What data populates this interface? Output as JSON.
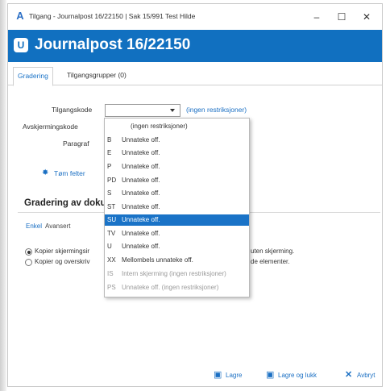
{
  "window": {
    "title": "Tilgang - Journalpost 16/22150 | Sak 15/991 Test Hilde",
    "app_icon": "A",
    "controls": {
      "minimize": "–",
      "maximize": "☐",
      "close": "✕"
    }
  },
  "header": {
    "logo": "U",
    "title": "Journalpost 16/22150",
    "color": "#1170c0"
  },
  "tabs": [
    {
      "label": "Gradering",
      "active": true
    },
    {
      "label": "Tilgangsgrupper (0)",
      "active": false
    }
  ],
  "form": {
    "tilgangskode_label": "Tilgangskode",
    "tilgangskode_value": "",
    "tilgangskode_hint": "(ingen restriksjoner)",
    "avskjermingskode_label": "Avskjermingskode",
    "paragraf_label": "Paragraf",
    "tom_felter": "Tøm felter"
  },
  "dropdown": {
    "options": [
      {
        "code": "",
        "desc": "(ingen restriksjoner)",
        "state": "normal"
      },
      {
        "code": "B",
        "desc": "Unnateke off.",
        "state": "normal"
      },
      {
        "code": "E",
        "desc": "Unnateke off.",
        "state": "normal"
      },
      {
        "code": "P",
        "desc": "Unnateke off.",
        "state": "normal"
      },
      {
        "code": "PD",
        "desc": "Unnateke off.",
        "state": "normal"
      },
      {
        "code": "S",
        "desc": "Unnateke off.",
        "state": "normal"
      },
      {
        "code": "ST",
        "desc": "Unnateke off.",
        "state": "normal"
      },
      {
        "code": "SU",
        "desc": "Unnateke off.",
        "state": "selected"
      },
      {
        "code": "TV",
        "desc": "Unnateke off.",
        "state": "normal"
      },
      {
        "code": "U",
        "desc": "Unnateke off.",
        "state": "normal"
      },
      {
        "code": "XX",
        "desc": "Mellombels unnateke off.",
        "state": "normal"
      },
      {
        "code": "IS",
        "desc": "Intern skjerming (ingen restriksjoner)",
        "state": "disabled"
      },
      {
        "code": "PS",
        "desc": "Unnateke off. (ingen restriksjoner)",
        "state": "disabled"
      }
    ]
  },
  "section": {
    "title_visible": "Gradering av doku",
    "subtabs": [
      {
        "label": "Enkel",
        "active": true
      },
      {
        "label": "Avansert",
        "active": false
      }
    ],
    "radios": [
      {
        "label_visible": "Kopier skjermingsir",
        "tail": "uten skjerming.",
        "checked": true
      },
      {
        "label_visible": "Kopier og overskriv",
        "tail": "de elementer.",
        "checked": false
      }
    ]
  },
  "buttons": {
    "lagre": "Lagre",
    "lagre_og_lukk": "Lagre og lukk",
    "avbryt": "Avbryt"
  }
}
